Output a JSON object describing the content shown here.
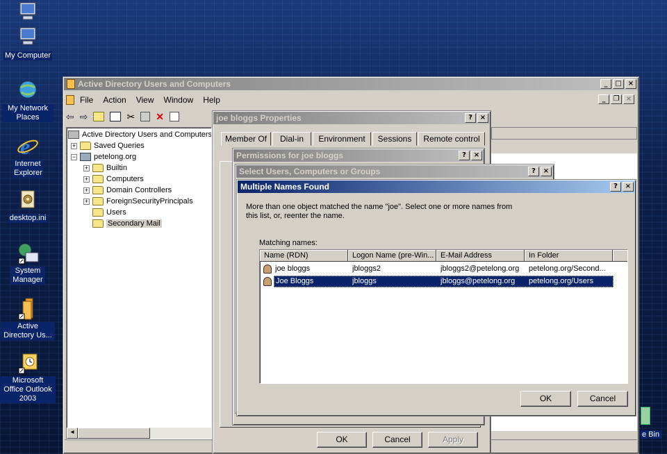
{
  "desktop": {
    "icons": [
      {
        "label": ""
      },
      {
        "label": "My Computer"
      },
      {
        "label": "My Network Places"
      },
      {
        "label": "Internet Explorer"
      },
      {
        "label": "desktop.ini"
      },
      {
        "label": "System Manager"
      },
      {
        "label": "Active Directory Us..."
      },
      {
        "label": "Microsoft Office Outlook 2003"
      }
    ],
    "recycle_label": "e Bin"
  },
  "aduc": {
    "title": "Active Directory Users and Computers",
    "menu": [
      {
        "label": "File"
      },
      {
        "label": "Action"
      },
      {
        "label": "View"
      },
      {
        "label": "Window"
      },
      {
        "label": "Help"
      }
    ],
    "tree": [
      {
        "label": "Active Directory Users and Computers"
      },
      {
        "label": "Saved Queries"
      },
      {
        "label": "petelong.org"
      },
      {
        "label": "Builtin"
      },
      {
        "label": "Computers"
      },
      {
        "label": "Domain Controllers"
      },
      {
        "label": "ForeignSecurityPrincipals"
      },
      {
        "label": "Users"
      },
      {
        "label": "Secondary Mail"
      }
    ]
  },
  "properties": {
    "title": "joe bloggs Properties",
    "tabs": [
      {
        "label": "Member Of"
      },
      {
        "label": "Dial-in"
      },
      {
        "label": "Environment"
      },
      {
        "label": "Sessions"
      },
      {
        "label": "Remote control"
      }
    ],
    "ok": "OK",
    "cancel": "Cancel",
    "apply": "Apply"
  },
  "permissions": {
    "title": "Permissions for joe bloggs"
  },
  "select": {
    "title": "Select Users, Computers or Groups"
  },
  "multiple": {
    "title": "Multiple Names Found",
    "message": "More than one object matched the name \"joe\". Select one or more names from this list, or, reenter the name.",
    "matching_label": "Matching names:",
    "columns": [
      "Name (RDN)",
      "Logon Name (pre-Win...",
      "E-Mail Address",
      "In Folder"
    ],
    "rows": [
      {
        "name": "joe bloggs",
        "logon": "jbloggs2",
        "email": "jbloggs2@petelong.org",
        "folder": "petelong.org/Second..."
      },
      {
        "name": "Joe Bloggs",
        "logon": "jbloggs",
        "email": "jbloggs@petelong.org",
        "folder": "petelong.org/Users"
      }
    ],
    "ok": "OK",
    "cancel": "Cancel"
  }
}
